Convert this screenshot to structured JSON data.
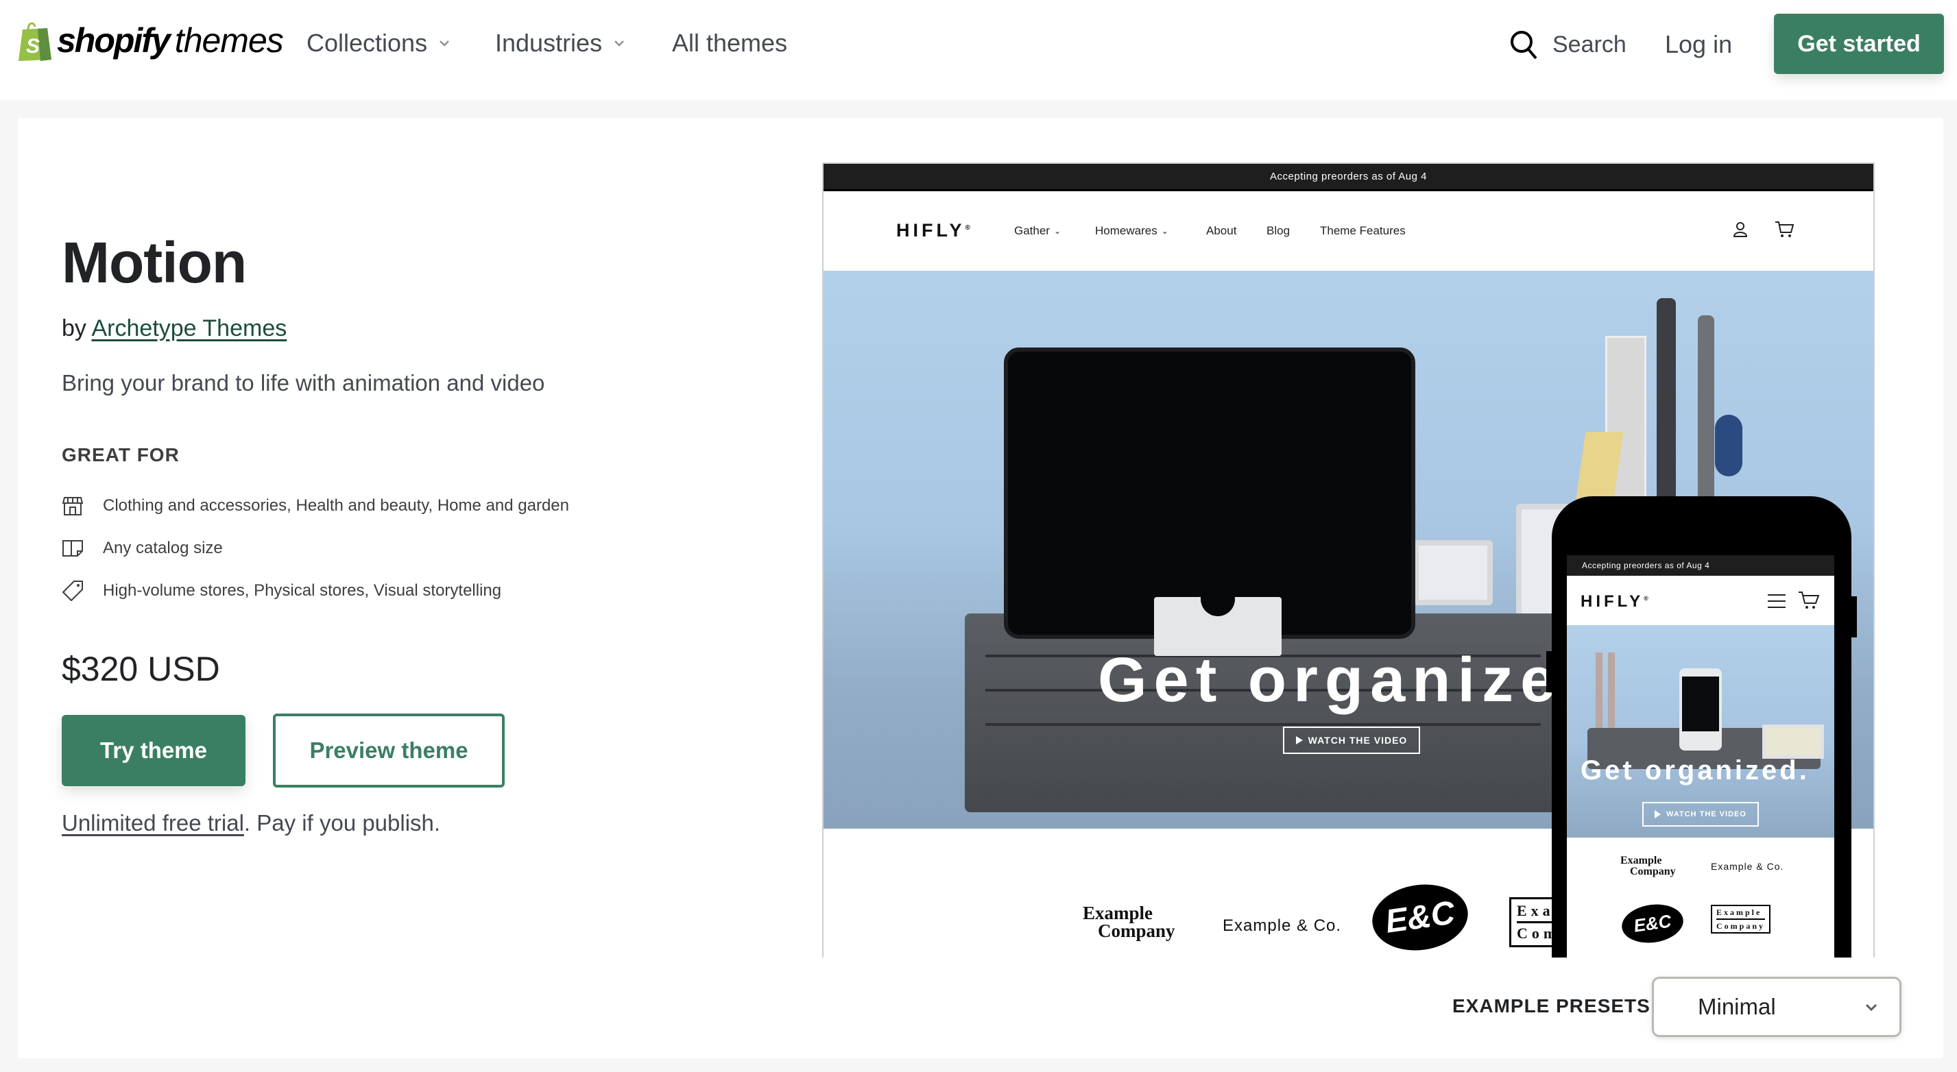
{
  "header": {
    "logo": {
      "brand": "shopify",
      "suffix": "themes",
      "icon": "shopify-bag-icon"
    },
    "nav": [
      {
        "label": "Collections",
        "has_dropdown": true
      },
      {
        "label": "Industries",
        "has_dropdown": true
      },
      {
        "label": "All themes",
        "has_dropdown": false
      }
    ],
    "search_label": "Search",
    "login_label": "Log in",
    "cta_label": "Get started"
  },
  "theme": {
    "name": "Motion",
    "by_prefix": "by",
    "author": "Archetype Themes",
    "tagline": "Bring your brand to life with animation and video",
    "great_for_heading": "GREAT FOR",
    "great_for": [
      {
        "icon": "storefront-icon",
        "text": "Clothing and accessories, Health and beauty, Home and garden"
      },
      {
        "icon": "catalog-book-icon",
        "text": "Any catalog size"
      },
      {
        "icon": "tag-icon",
        "text": "High-volume stores, Physical stores, Visual storytelling"
      }
    ],
    "price": "$320 USD",
    "try_label": "Try theme",
    "preview_label": "Preview theme",
    "trial_link": "Unlimited free trial",
    "trial_suffix": ". Pay if you publish."
  },
  "preview": {
    "announcement": "Accepting preorders as of Aug 4",
    "store_logo": "HIFLY",
    "store_logo_mark": "®",
    "nav": [
      {
        "label": "Gather",
        "has_dropdown": true
      },
      {
        "label": "Homewares",
        "has_dropdown": true
      },
      {
        "label": "About",
        "has_dropdown": false
      },
      {
        "label": "Blog",
        "has_dropdown": false
      },
      {
        "label": "Theme Features",
        "has_dropdown": false
      }
    ],
    "hero_headline_desktop": "Get organized",
    "hero_headline_mobile": "Get organized.",
    "watch_label": "WATCH THE VIDEO",
    "brands": {
      "example_company_line1": "Example",
      "example_company_line2": "Company",
      "example_co": "Example & Co.",
      "ec": "E&C",
      "boxed_line1": "Example",
      "boxed_line2": "Company",
      "boxed_line1_cut": "Exa",
      "boxed_line2_cut": "Com"
    }
  },
  "presets": {
    "label": "EXAMPLE PRESETS",
    "selected": "Minimal"
  },
  "colors": {
    "brand_green": "#3b7f62",
    "link_green": "#1d4d3a",
    "logo_bag_green": "#95bf47",
    "page_bg": "#f6f6f7",
    "text": "#212326",
    "muted_text": "#454a51"
  }
}
